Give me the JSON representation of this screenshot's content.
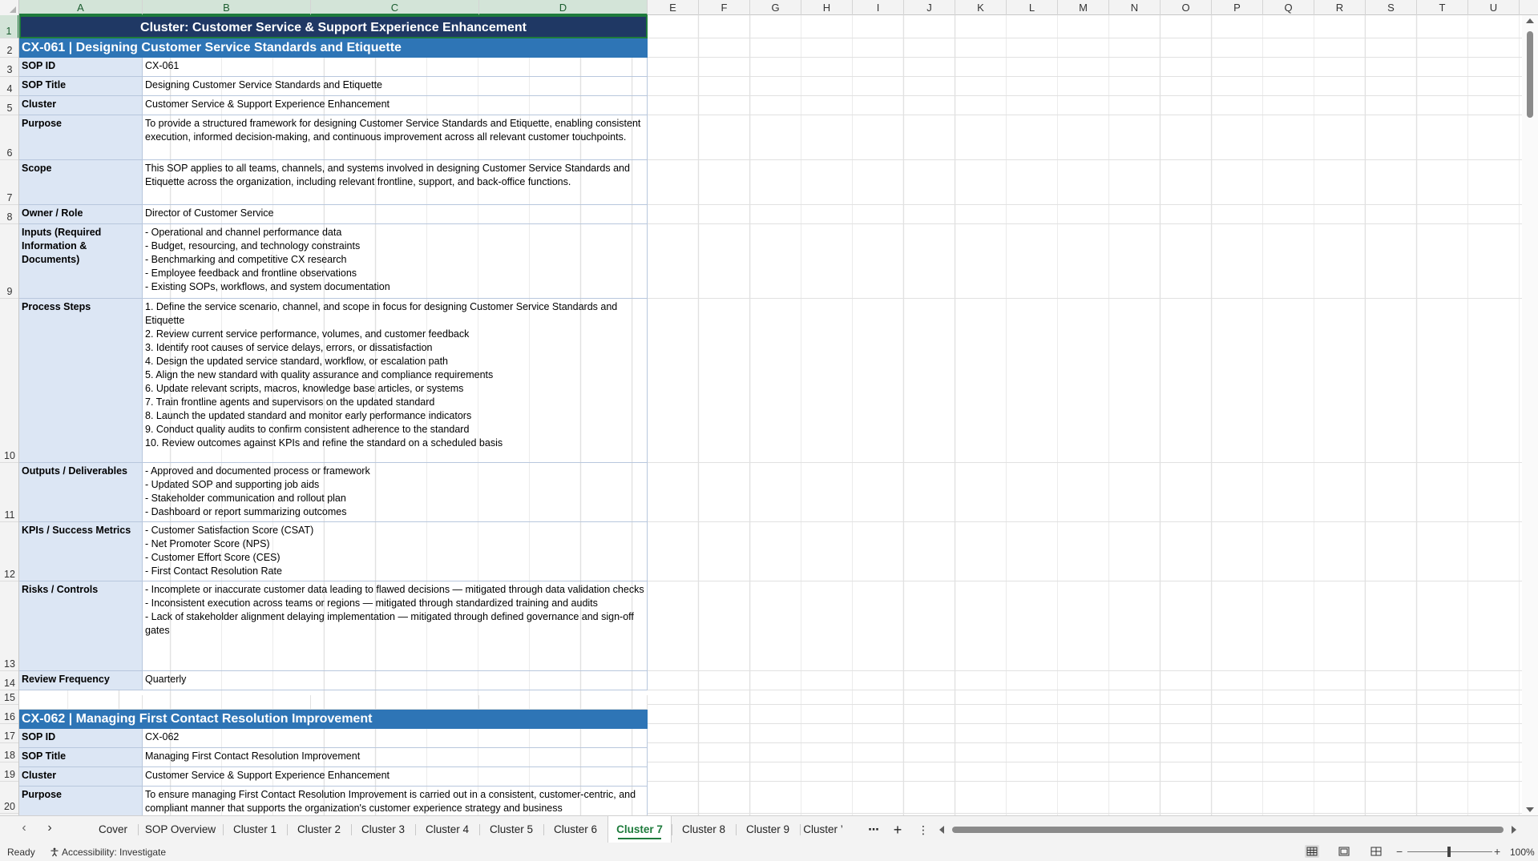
{
  "columns": [
    "A",
    "B",
    "C",
    "D",
    "E",
    "F",
    "G",
    "H",
    "I",
    "J",
    "K",
    "L",
    "M",
    "N",
    "O",
    "P",
    "Q",
    "R",
    "S",
    "T",
    "U"
  ],
  "rows": [
    "1",
    "2",
    "3",
    "4",
    "5",
    "6",
    "7",
    "8",
    "9",
    "10",
    "11",
    "12",
    "13",
    "14",
    "15",
    "16",
    "17",
    "18",
    "19",
    "20"
  ],
  "sheet": {
    "title": "Cluster: Customer Service & Support Experience Enhancement",
    "sop1": {
      "header": "CX-061  |  Designing Customer Service Standards and Etiquette",
      "fields": [
        {
          "label": "SOP ID",
          "value": "CX-061"
        },
        {
          "label": "SOP Title",
          "value": "Designing Customer Service Standards and Etiquette"
        },
        {
          "label": "Cluster",
          "value": "Customer Service & Support Experience Enhancement"
        },
        {
          "label": "Purpose",
          "value": "To provide a structured framework for designing Customer Service Standards and Etiquette, enabling consistent execution, informed decision-making, and continuous improvement across all relevant customer touchpoints."
        },
        {
          "label": "Scope",
          "value": "This SOP applies to all teams, channels, and systems involved in designing Customer Service Standards and Etiquette across the organization, including relevant frontline, support, and back-office functions."
        },
        {
          "label": "Owner / Role",
          "value": "Director of Customer Service"
        },
        {
          "label": "Inputs (Required Information & Documents)",
          "value": "- Operational and channel performance data\n- Budget, resourcing, and technology constraints\n- Benchmarking and competitive CX research\n- Employee feedback and frontline observations\n- Existing SOPs, workflows, and system documentation"
        },
        {
          "label": "Process Steps",
          "value": "1. Define the service scenario, channel, and scope in focus for designing Customer Service Standards and Etiquette\n2. Review current service performance, volumes, and customer feedback\n3. Identify root causes of service delays, errors, or dissatisfaction\n4. Design the updated service standard, workflow, or escalation path\n5. Align the new standard with quality assurance and compliance requirements\n6. Update relevant scripts, macros, knowledge base articles, or systems\n7. Train frontline agents and supervisors on the updated standard\n8. Launch the updated standard and monitor early performance indicators\n9. Conduct quality audits to confirm consistent adherence to the standard\n10. Review outcomes against KPIs and refine the standard on a scheduled basis"
        },
        {
          "label": "Outputs / Deliverables",
          "value": "- Approved and documented process or framework\n- Updated SOP and supporting job aids\n- Stakeholder communication and rollout plan\n- Dashboard or report summarizing outcomes"
        },
        {
          "label": "KPIs / Success Metrics",
          "value": "- Customer Satisfaction Score (CSAT)\n- Net Promoter Score (NPS)\n- Customer Effort Score (CES)\n- First Contact Resolution Rate"
        },
        {
          "label": "Risks / Controls",
          "value": "- Incomplete or inaccurate customer data leading to flawed decisions — mitigated through data validation checks\n- Inconsistent execution across teams or regions — mitigated through standardized training and audits\n- Lack of stakeholder alignment delaying implementation — mitigated through defined governance and sign-off gates"
        },
        {
          "label": "Review Frequency",
          "value": "Quarterly"
        }
      ]
    },
    "sop2": {
      "header": "CX-062  |  Managing First Contact Resolution Improvement",
      "fields": [
        {
          "label": "SOP ID",
          "value": "CX-062"
        },
        {
          "label": "SOP Title",
          "value": "Managing First Contact Resolution Improvement"
        },
        {
          "label": "Cluster",
          "value": "Customer Service & Support Experience Enhancement"
        },
        {
          "label": "Purpose",
          "value": "To ensure managing First Contact Resolution Improvement is carried out in a consistent, customer-centric, and compliant manner that supports the organization's customer experience strategy and business"
        }
      ]
    }
  },
  "tabs": [
    "Cover",
    "SOP Overview",
    "Cluster 1",
    "Cluster 2",
    "Cluster 3",
    "Cluster 4",
    "Cluster 5",
    "Cluster 6",
    "Cluster 7",
    "Cluster 8",
    "Cluster 9",
    "Cluster ’"
  ],
  "active_tab": "Cluster 7",
  "status": {
    "ready": "Ready",
    "accessibility": "Accessibility: Investigate",
    "zoom": "100%"
  },
  "colors": {
    "title_bg": "#1f3864",
    "sop_header_bg": "#2e75b6",
    "label_bg": "#dce6f4",
    "accent": "#1e7b3c"
  }
}
